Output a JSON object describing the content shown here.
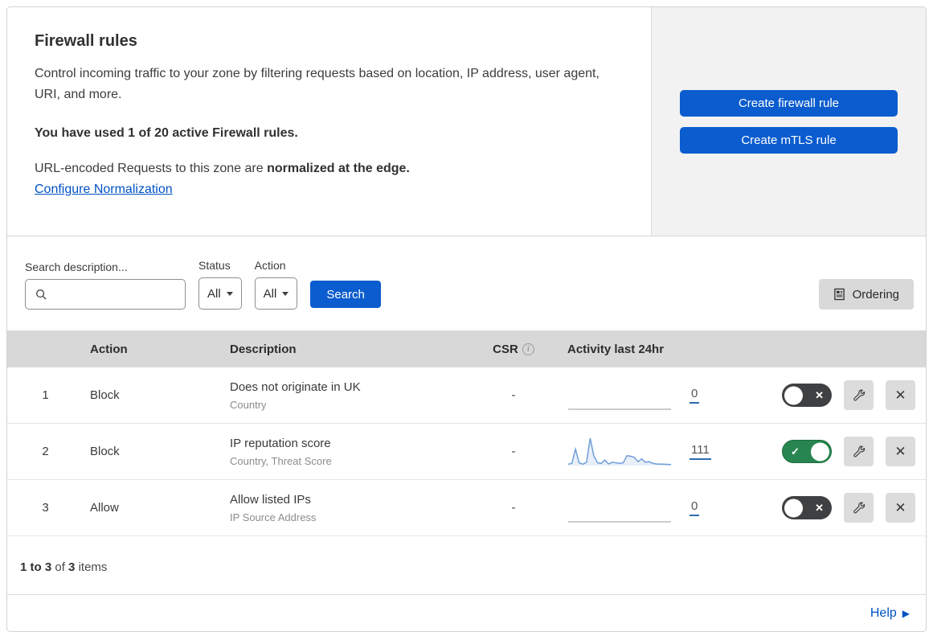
{
  "colors": {
    "primary_blue": "#0b5cce",
    "link_blue": "#0051c3",
    "toggle_on_green": "#27864f",
    "toggle_off_gray": "#3f4042",
    "table_header_gray": "#d8d8d8",
    "panel_gray": "#f2f2f2",
    "sparkline_blue": "#6f9ed9"
  },
  "header": {
    "title": "Firewall rules",
    "description": "Control incoming traffic to your zone by filtering requests based on location, IP address, user agent, URI, and more.",
    "usage": "You have used 1 of 20 active Firewall rules.",
    "normalization_prefix": "URL-encoded Requests to this zone are ",
    "normalization_bold": "normalized at the edge.",
    "normalization_link": "Configure Normalization",
    "create_firewall_button": "Create firewall rule",
    "create_mtls_button": "Create mTLS rule"
  },
  "filters": {
    "search_label": "Search description...",
    "search_value": "",
    "status": {
      "label": "Status",
      "value": "All"
    },
    "action": {
      "label": "Action",
      "value": "All"
    },
    "search_button": "Search",
    "ordering_button": "Ordering"
  },
  "table": {
    "columns": {
      "action": "Action",
      "description": "Description",
      "csr": "CSR",
      "activity": "Activity last 24hr"
    },
    "rows": [
      {
        "priority": "1",
        "action": "Block",
        "description": "Does not originate in UK",
        "fields": "Country",
        "csr": "-",
        "activity_count": "0",
        "enabled": false,
        "activity_sparkline": [
          0,
          0,
          0,
          0,
          0,
          0,
          0,
          0,
          0,
          0,
          0,
          0,
          0,
          0,
          0,
          0,
          0,
          0,
          0,
          0,
          0,
          0,
          0,
          0
        ]
      },
      {
        "priority": "2",
        "action": "Block",
        "description": "IP reputation score",
        "fields": "Country, Threat Score",
        "csr": "-",
        "activity_count": "111",
        "enabled": true,
        "activity_sparkline": [
          5,
          8,
          60,
          10,
          5,
          12,
          100,
          35,
          10,
          8,
          20,
          6,
          12,
          10,
          8,
          10,
          36,
          34,
          30,
          14,
          24,
          12,
          14,
          8,
          6,
          5,
          5,
          4,
          4
        ]
      },
      {
        "priority": "3",
        "action": "Allow",
        "description": "Allow listed IPs",
        "fields": "IP Source Address",
        "csr": "-",
        "activity_count": "0",
        "enabled": false,
        "activity_sparkline": [
          0,
          0,
          0,
          0,
          0,
          0,
          0,
          0,
          0,
          0,
          0,
          0,
          0,
          0,
          0,
          0,
          0,
          0,
          0,
          0,
          0,
          0,
          0,
          0
        ]
      }
    ]
  },
  "footer": {
    "range": "1 to 3",
    "of_label": "of",
    "total": "3",
    "items_label": "items",
    "help": "Help"
  }
}
